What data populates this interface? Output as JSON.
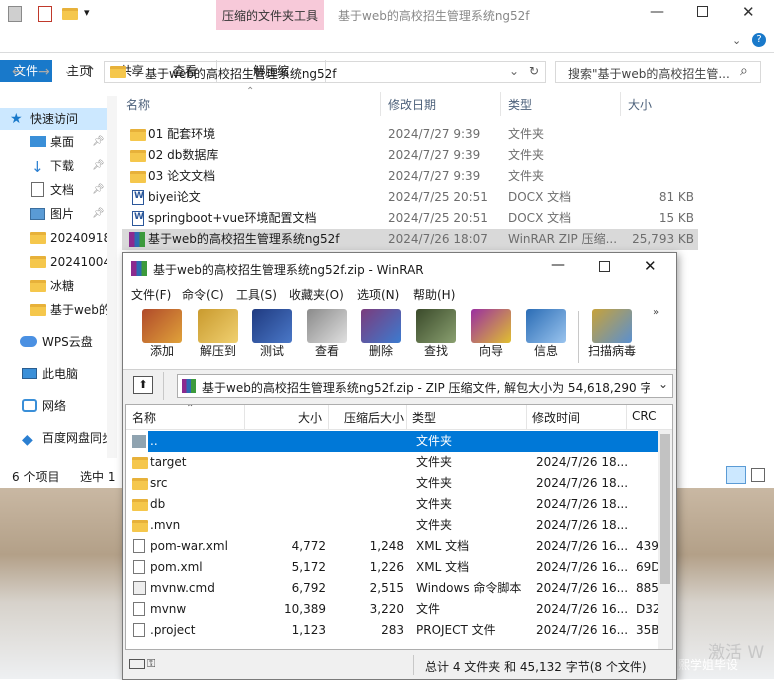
{
  "explorer": {
    "title": "基于web的高校招生管理系统ng52f",
    "contextual_tab": "压缩的文件夹工具",
    "tabs": [
      "文件",
      "主页",
      "共享",
      "查看",
      "解压缩"
    ],
    "address": "基于web的高校招生管理系统ng52f",
    "search_placeholder": "搜索\"基于web的高校招生管...",
    "columns": [
      "名称",
      "修改日期",
      "类型",
      "大小"
    ],
    "files": [
      {
        "name": "01 配套环境",
        "date": "2024/7/27 9:39",
        "type": "文件夹",
        "size": "",
        "icon": "folder-icon"
      },
      {
        "name": "02 db数据库",
        "date": "2024/7/27 9:39",
        "type": "文件夹",
        "size": "",
        "icon": "folder-icon"
      },
      {
        "name": "03 论文文档",
        "date": "2024/7/27 9:39",
        "type": "文件夹",
        "size": "",
        "icon": "folder-icon"
      },
      {
        "name": "biyei论文",
        "date": "2024/7/25 20:51",
        "type": "DOCX 文档",
        "size": "81 KB",
        "icon": "docx-icon"
      },
      {
        "name": "springboot+vue环境配置文档",
        "date": "2024/7/25 20:51",
        "type": "DOCX 文档",
        "size": "15 KB",
        "icon": "docx-icon"
      },
      {
        "name": "基于web的高校招生管理系统ng52f",
        "date": "2024/7/26 18:07",
        "type": "WinRAR ZIP 压缩...",
        "size": "25,793 KB",
        "icon": "winrar-icon"
      }
    ],
    "nav": {
      "quick_access": "快速访问",
      "items": [
        {
          "label": "桌面",
          "icon": "desktop-icon"
        },
        {
          "label": "下载",
          "icon": "download-icon"
        },
        {
          "label": "文档",
          "icon": "documents-icon"
        },
        {
          "label": "图片",
          "icon": "pictures-icon"
        },
        {
          "label": "20240918",
          "icon": "folder-icon"
        },
        {
          "label": "20241004",
          "icon": "folder-icon"
        },
        {
          "label": "冰糖",
          "icon": "folder-icon"
        },
        {
          "label": "基于web的",
          "icon": "folder-icon"
        }
      ],
      "wps": "WPS云盘",
      "this_pc": "此电脑",
      "network": "网络",
      "baidu": "百度网盘同步"
    },
    "status_count": "6 个项目",
    "status_selected": "选中 1"
  },
  "winrar": {
    "title": "基于web的高校招生管理系统ng52f.zip - WinRAR",
    "menu": [
      "文件(F)",
      "命令(C)",
      "工具(S)",
      "收藏夹(O)",
      "选项(N)",
      "帮助(H)"
    ],
    "toolbar": [
      {
        "label": "添加",
        "icon": "add-archive-icon",
        "color": "#b04a2a"
      },
      {
        "label": "解压到",
        "icon": "extract-to-icon",
        "color": "#c99a2e"
      },
      {
        "label": "测试",
        "icon": "test-icon",
        "color": "#2b4fa0"
      },
      {
        "label": "查看",
        "icon": "view-icon",
        "color": "#7a7a7a"
      },
      {
        "label": "删除",
        "icon": "delete-icon",
        "color": "#7b3b7c"
      },
      {
        "label": "查找",
        "icon": "find-icon",
        "color": "#4e5a3a"
      },
      {
        "label": "向导",
        "icon": "wizard-icon",
        "color": "#9a2fa0"
      },
      {
        "label": "信息",
        "icon": "info-icon",
        "color": "#2a6cb5"
      },
      {
        "label": "扫描病毒",
        "icon": "scan-virus-icon",
        "color": "#c7a23a"
      }
    ],
    "path": "基于web的高校招生管理系统ng52f.zip - ZIP 压缩文件, 解包大小为 54,618,290 字节",
    "columns": [
      "名称",
      "大小",
      "压缩后大小",
      "类型",
      "修改时间",
      "CRC"
    ],
    "files": [
      {
        "name": "..",
        "size": "",
        "packed": "",
        "type": "文件夹",
        "modified": "",
        "crc": "",
        "icon": "parent-folder-icon"
      },
      {
        "name": "target",
        "size": "",
        "packed": "",
        "type": "文件夹",
        "modified": "2024/7/26 18...",
        "crc": "",
        "icon": "folder-icon"
      },
      {
        "name": "src",
        "size": "",
        "packed": "",
        "type": "文件夹",
        "modified": "2024/7/26 18...",
        "crc": "",
        "icon": "folder-icon"
      },
      {
        "name": "db",
        "size": "",
        "packed": "",
        "type": "文件夹",
        "modified": "2024/7/26 18...",
        "crc": "",
        "icon": "folder-icon"
      },
      {
        "name": ".mvn",
        "size": "",
        "packed": "",
        "type": "文件夹",
        "modified": "2024/7/26 18...",
        "crc": "",
        "icon": "folder-icon"
      },
      {
        "name": "pom-war.xml",
        "size": "4,772",
        "packed": "1,248",
        "type": "XML 文档",
        "modified": "2024/7/26 16...",
        "crc": "439",
        "icon": "xml-file-icon"
      },
      {
        "name": "pom.xml",
        "size": "5,172",
        "packed": "1,226",
        "type": "XML 文档",
        "modified": "2024/7/26 16...",
        "crc": "69D",
        "icon": "xml-file-icon"
      },
      {
        "name": "mvnw.cmd",
        "size": "6,792",
        "packed": "2,515",
        "type": "Windows 命令脚本",
        "modified": "2024/7/26 16...",
        "crc": "885",
        "icon": "cmd-file-icon"
      },
      {
        "name": "mvnw",
        "size": "10,389",
        "packed": "3,220",
        "type": "文件",
        "modified": "2024/7/26 16...",
        "crc": "D32",
        "icon": "file-icon"
      },
      {
        "name": ".project",
        "size": "1,123",
        "packed": "283",
        "type": "PROJECT 文件",
        "modified": "2024/7/26 16...",
        "crc": "35B",
        "icon": "file-icon"
      }
    ],
    "status": "总计 4 文件夹 和 45,132 字节(8 个文件)"
  },
  "desktop": {
    "activate": "激活 W",
    "watermark": "CSDN @荣熙学姐毕设"
  },
  "colors": {
    "accent": "#0078d7",
    "contextual": "#f7c9d9"
  }
}
